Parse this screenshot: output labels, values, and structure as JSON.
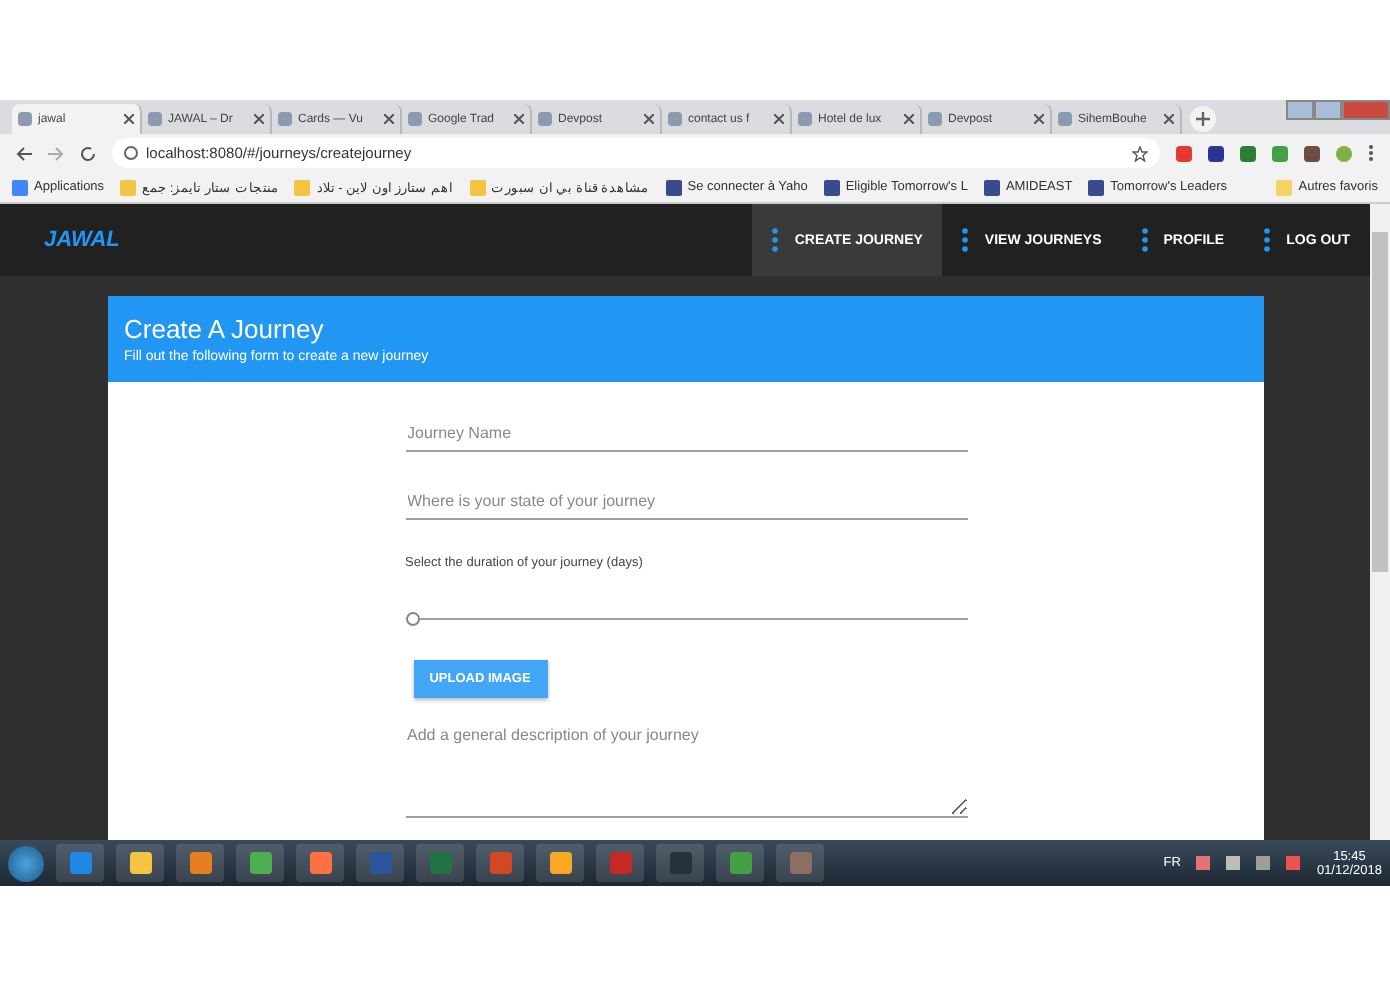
{
  "browser": {
    "tabs": [
      {
        "title": "jawal",
        "selected": true
      },
      {
        "title": "JAWAL – Dr",
        "selected": false
      },
      {
        "title": "Cards — Vu",
        "selected": false
      },
      {
        "title": "Google Trad",
        "selected": false
      },
      {
        "title": "Devpost",
        "selected": false
      },
      {
        "title": "contact us f",
        "selected": false
      },
      {
        "title": "Hotel de lux",
        "selected": false
      },
      {
        "title": "Devpost",
        "selected": false
      },
      {
        "title": "SihemBouhe",
        "selected": false
      }
    ],
    "address": "localhost:8080/#/journeys/createjourney",
    "bookmarks": [
      "Applications",
      "منتجات ستار تايمز: جمع",
      "اهم ستارز اون لاين - تلاد",
      "مشاهدة قناة بي ان سبورت",
      "Se connecter à Yaho",
      "Eligible Tomorrow's L",
      "AMIDEAST",
      "Tomorrow's Leaders"
    ],
    "other_bookmarks": "Autres favoris"
  },
  "app": {
    "logo": "JAWAL",
    "nav": [
      {
        "label": "CREATE JOURNEY",
        "selected": true
      },
      {
        "label": "VIEW JOURNEYS",
        "selected": false
      },
      {
        "label": "PROFILE",
        "selected": false
      },
      {
        "label": "LOG OUT",
        "selected": false
      }
    ]
  },
  "form": {
    "title": "Create A Journey",
    "subtitle": "Fill out the following form to create a new journey",
    "fields": [
      {
        "placeholder": "Journey Name"
      },
      {
        "placeholder": "Where is your state of your journey"
      }
    ],
    "duration_label": "Select the duration of your journey (days)",
    "duration": {
      "level": 0
    },
    "upload_button": "UPLOAD IMAGE",
    "description": {
      "placeholder": "Add a general description of your journey"
    }
  },
  "taskbar": {
    "language": "FR",
    "time": "15:45",
    "date": "01/12/2018"
  }
}
